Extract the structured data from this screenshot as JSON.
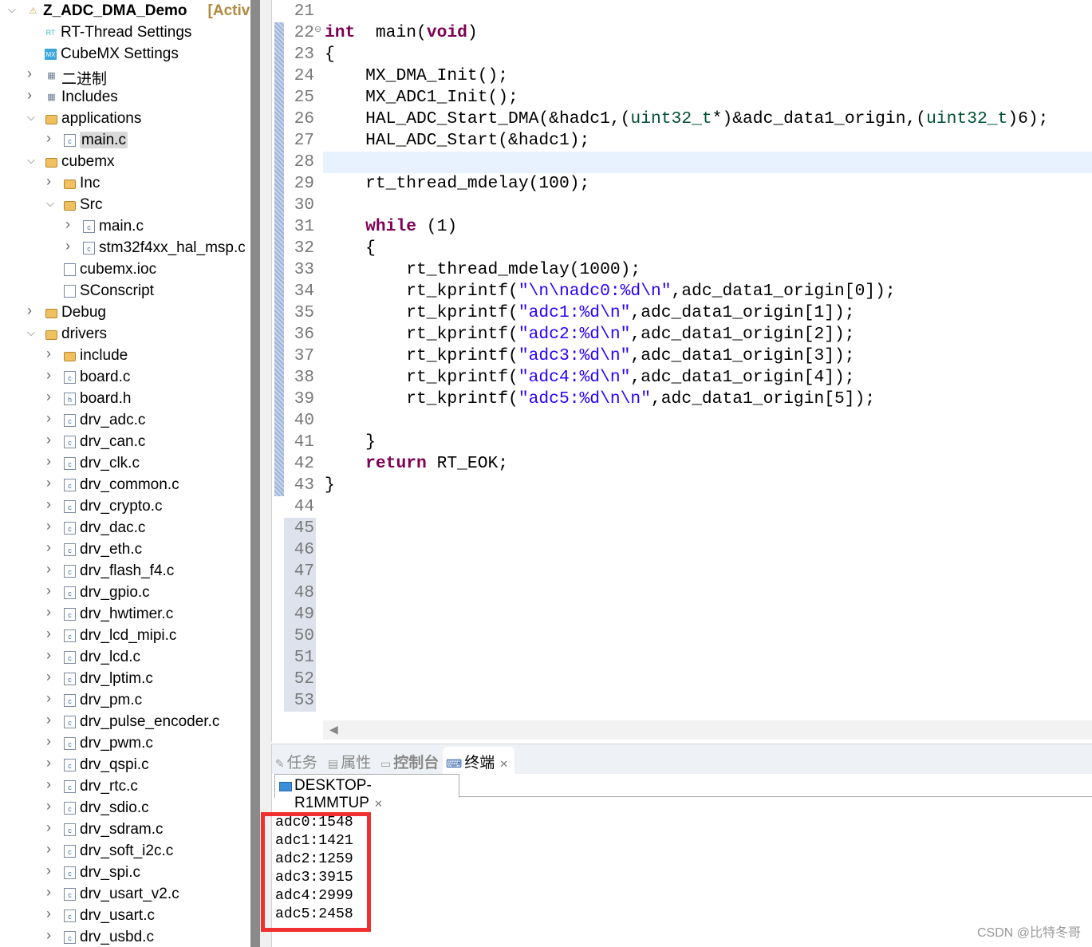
{
  "project_explorer": {
    "items": [
      {
        "label": "Z_ADC_DMA_Demo",
        "suffix": "[Activ",
        "level": 0,
        "chevron": "down",
        "icon": "project-icon",
        "bold": true
      },
      {
        "label": "RT-Thread Settings",
        "level": 1,
        "chevron": "none",
        "icon": "rt-thread-icon"
      },
      {
        "label": "CubeMX Settings",
        "level": 1,
        "chevron": "none",
        "icon": "cubemx-icon"
      },
      {
        "label": "二进制",
        "level": 1,
        "chevron": "right",
        "icon": "binaries-icon"
      },
      {
        "label": "Includes",
        "level": 1,
        "chevron": "right",
        "icon": "includes-icon"
      },
      {
        "label": "applications",
        "level": 1,
        "chevron": "down",
        "icon": "folder-icon"
      },
      {
        "label": "main.c",
        "level": 2,
        "chevron": "right",
        "icon": "c-file-icon",
        "selected": true
      },
      {
        "label": "cubemx",
        "level": 1,
        "chevron": "down",
        "icon": "folder-icon"
      },
      {
        "label": "Inc",
        "level": 2,
        "chevron": "right",
        "icon": "folder-icon"
      },
      {
        "label": "Src",
        "level": 2,
        "chevron": "down",
        "icon": "folder-icon"
      },
      {
        "label": "main.c",
        "level": 3,
        "chevron": "right",
        "icon": "c-file-icon"
      },
      {
        "label": "stm32f4xx_hal_msp.c",
        "level": 3,
        "chevron": "right",
        "icon": "c-file-icon"
      },
      {
        "label": "cubemx.ioc",
        "level": 2,
        "chevron": "none",
        "icon": "file-icon"
      },
      {
        "label": "SConscript",
        "level": 2,
        "chevron": "none",
        "icon": "file-icon"
      },
      {
        "label": "Debug",
        "level": 1,
        "chevron": "right",
        "icon": "folder-icon"
      },
      {
        "label": "drivers",
        "level": 1,
        "chevron": "down",
        "icon": "folder-icon"
      },
      {
        "label": "include",
        "level": 2,
        "chevron": "right",
        "icon": "folder-icon"
      },
      {
        "label": "board.c",
        "level": 2,
        "chevron": "right",
        "icon": "c-file-icon"
      },
      {
        "label": "board.h",
        "level": 2,
        "chevron": "right",
        "icon": "h-file-icon"
      },
      {
        "label": "drv_adc.c",
        "level": 2,
        "chevron": "right",
        "icon": "c-file-icon"
      },
      {
        "label": "drv_can.c",
        "level": 2,
        "chevron": "right",
        "icon": "c-file-icon"
      },
      {
        "label": "drv_clk.c",
        "level": 2,
        "chevron": "right",
        "icon": "c-file-icon"
      },
      {
        "label": "drv_common.c",
        "level": 2,
        "chevron": "right",
        "icon": "c-file-icon"
      },
      {
        "label": "drv_crypto.c",
        "level": 2,
        "chevron": "right",
        "icon": "c-file-icon"
      },
      {
        "label": "drv_dac.c",
        "level": 2,
        "chevron": "right",
        "icon": "c-file-icon"
      },
      {
        "label": "drv_eth.c",
        "level": 2,
        "chevron": "right",
        "icon": "c-file-icon"
      },
      {
        "label": "drv_flash_f4.c",
        "level": 2,
        "chevron": "right",
        "icon": "c-file-icon"
      },
      {
        "label": "drv_gpio.c",
        "level": 2,
        "chevron": "right",
        "icon": "c-file-icon"
      },
      {
        "label": "drv_hwtimer.c",
        "level": 2,
        "chevron": "right",
        "icon": "c-file-icon"
      },
      {
        "label": "drv_lcd_mipi.c",
        "level": 2,
        "chevron": "right",
        "icon": "c-file-icon"
      },
      {
        "label": "drv_lcd.c",
        "level": 2,
        "chevron": "right",
        "icon": "c-file-icon"
      },
      {
        "label": "drv_lptim.c",
        "level": 2,
        "chevron": "right",
        "icon": "c-file-icon"
      },
      {
        "label": "drv_pm.c",
        "level": 2,
        "chevron": "right",
        "icon": "c-file-icon"
      },
      {
        "label": "drv_pulse_encoder.c",
        "level": 2,
        "chevron": "right",
        "icon": "c-file-icon"
      },
      {
        "label": "drv_pwm.c",
        "level": 2,
        "chevron": "right",
        "icon": "c-file-icon"
      },
      {
        "label": "drv_qspi.c",
        "level": 2,
        "chevron": "right",
        "icon": "c-file-icon"
      },
      {
        "label": "drv_rtc.c",
        "level": 2,
        "chevron": "right",
        "icon": "c-file-icon"
      },
      {
        "label": "drv_sdio.c",
        "level": 2,
        "chevron": "right",
        "icon": "c-file-icon"
      },
      {
        "label": "drv_sdram.c",
        "level": 2,
        "chevron": "right",
        "icon": "c-file-icon"
      },
      {
        "label": "drv_soft_i2c.c",
        "level": 2,
        "chevron": "right",
        "icon": "c-file-icon"
      },
      {
        "label": "drv_spi.c",
        "level": 2,
        "chevron": "right",
        "icon": "c-file-icon"
      },
      {
        "label": "drv_usart_v2.c",
        "level": 2,
        "chevron": "right",
        "icon": "c-file-icon"
      },
      {
        "label": "drv_usart.c",
        "level": 2,
        "chevron": "right",
        "icon": "c-file-icon"
      },
      {
        "label": "drv_usbd.c",
        "level": 2,
        "chevron": "right",
        "icon": "c-file-icon"
      }
    ]
  },
  "editor": {
    "current_line": 28,
    "lines": [
      {
        "n": "21",
        "t": []
      },
      {
        "n": "22",
        "fold": true,
        "t": [
          [
            "kw",
            "int"
          ],
          [
            "",
            "  main("
          ],
          [
            "kw",
            "void"
          ],
          [
            "",
            ")"
          ]
        ]
      },
      {
        "n": "23",
        "t": [
          [
            "",
            "{"
          ]
        ]
      },
      {
        "n": "24",
        "t": [
          [
            "",
            "    MX_DMA_Init();"
          ]
        ]
      },
      {
        "n": "25",
        "t": [
          [
            "",
            "    MX_ADC1_Init();"
          ]
        ]
      },
      {
        "n": "26",
        "t": [
          [
            "",
            "    HAL_ADC_Start_DMA(&hadc1,("
          ],
          [
            "ty",
            "uint32_t"
          ],
          [
            "",
            "*)&adc_data1_origin,("
          ],
          [
            "ty",
            "uint32_t"
          ],
          [
            "",
            ")6);"
          ]
        ]
      },
      {
        "n": "27",
        "t": [
          [
            "",
            "    HAL_ADC_Start(&hadc1);"
          ]
        ]
      },
      {
        "n": "28",
        "t": []
      },
      {
        "n": "29",
        "t": [
          [
            "",
            "    rt_thread_mdelay(100);"
          ]
        ]
      },
      {
        "n": "30",
        "t": []
      },
      {
        "n": "31",
        "t": [
          [
            "",
            "    "
          ],
          [
            "kw",
            "while"
          ],
          [
            "",
            " (1)"
          ]
        ]
      },
      {
        "n": "32",
        "t": [
          [
            "",
            "    {"
          ]
        ]
      },
      {
        "n": "33",
        "t": [
          [
            "",
            "        rt_thread_mdelay(1000);"
          ]
        ]
      },
      {
        "n": "34",
        "t": [
          [
            "",
            "        rt_kprintf("
          ],
          [
            "st",
            "\"\\n\\nadc0:%d\\n\""
          ],
          [
            "",
            ",adc_data1_origin[0]);"
          ]
        ]
      },
      {
        "n": "35",
        "t": [
          [
            "",
            "        rt_kprintf("
          ],
          [
            "st",
            "\"adc1:%d\\n\""
          ],
          [
            "",
            ",adc_data1_origin[1]);"
          ]
        ]
      },
      {
        "n": "36",
        "t": [
          [
            "",
            "        rt_kprintf("
          ],
          [
            "st",
            "\"adc2:%d\\n\""
          ],
          [
            "",
            ",adc_data1_origin[2]);"
          ]
        ]
      },
      {
        "n": "37",
        "t": [
          [
            "",
            "        rt_kprintf("
          ],
          [
            "st",
            "\"adc3:%d\\n\""
          ],
          [
            "",
            ",adc_data1_origin[3]);"
          ]
        ]
      },
      {
        "n": "38",
        "t": [
          [
            "",
            "        rt_kprintf("
          ],
          [
            "st",
            "\"adc4:%d\\n\""
          ],
          [
            "",
            ",adc_data1_origin[4]);"
          ]
        ]
      },
      {
        "n": "39",
        "t": [
          [
            "",
            "        rt_kprintf("
          ],
          [
            "st",
            "\"adc5:%d\\n\\n\""
          ],
          [
            "",
            ",adc_data1_origin[5]);"
          ]
        ]
      },
      {
        "n": "40",
        "t": []
      },
      {
        "n": "41",
        "t": [
          [
            "",
            "    }"
          ]
        ]
      },
      {
        "n": "42",
        "t": [
          [
            "",
            "    "
          ],
          [
            "kw",
            "return"
          ],
          [
            "",
            " RT_EOK;"
          ]
        ]
      },
      {
        "n": "43",
        "t": [
          [
            "",
            "}"
          ]
        ]
      },
      {
        "n": "44",
        "t": []
      },
      {
        "n": "45",
        "alt": true,
        "t": []
      },
      {
        "n": "46",
        "alt": true,
        "t": []
      },
      {
        "n": "47",
        "alt": true,
        "t": []
      },
      {
        "n": "48",
        "alt": true,
        "t": []
      },
      {
        "n": "49",
        "alt": true,
        "t": []
      },
      {
        "n": "50",
        "alt": true,
        "t": []
      },
      {
        "n": "51",
        "alt": true,
        "t": []
      },
      {
        "n": "52",
        "alt": true,
        "t": []
      },
      {
        "n": "53",
        "alt": true,
        "t": []
      }
    ]
  },
  "bottom_panel": {
    "tabs": [
      {
        "label": "任务",
        "icon": "tasks-icon"
      },
      {
        "label": "属性",
        "icon": "properties-icon"
      },
      {
        "label": "控制台",
        "icon": "console-icon"
      },
      {
        "label": "终端",
        "icon": "terminal-icon",
        "active": true
      }
    ],
    "terminal_tab": "DESKTOP-R1MMTUP",
    "output": [
      "adc0:1548",
      "adc1:1421",
      "adc2:1259",
      "adc3:3915",
      "adc4:2999",
      "adc5:2458"
    ]
  },
  "highlight_color": "#f03030",
  "watermark": "CSDN @比特冬哥"
}
